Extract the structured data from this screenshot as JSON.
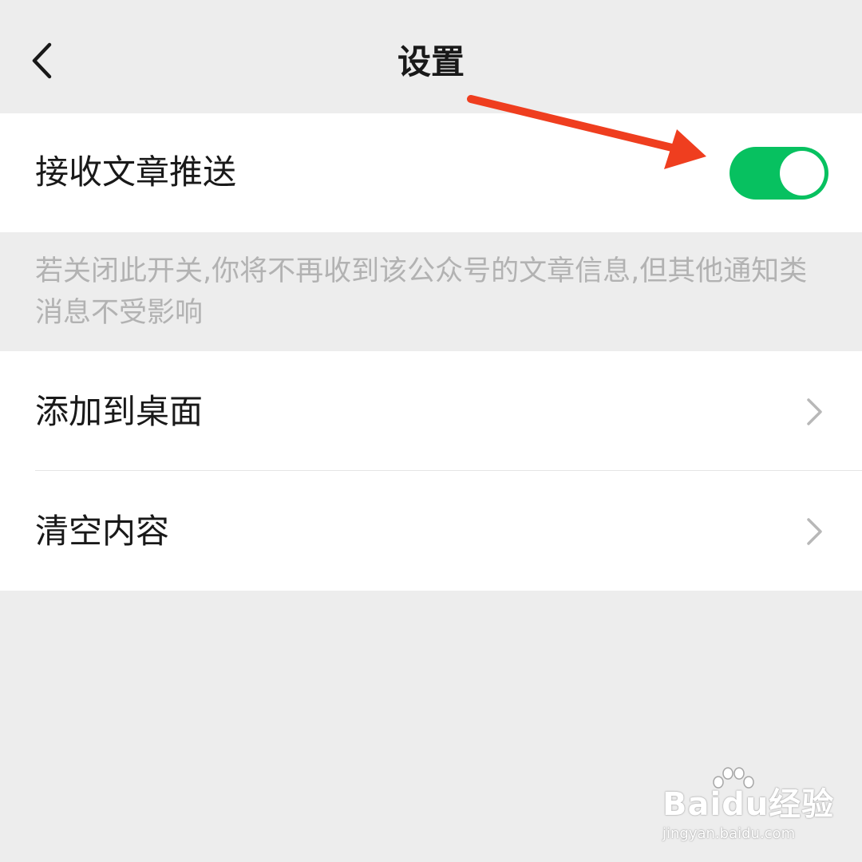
{
  "header": {
    "title": "设置",
    "back_icon": "chevron-left-icon"
  },
  "push_setting": {
    "label": "接收文章推送",
    "enabled": true,
    "toggle_color": "#07c160",
    "hint": "若关闭此开关,你将不再收到该公众号的文章信息,但其他通知类消息不受影响"
  },
  "actions": [
    {
      "label": "添加到桌面",
      "icon": "chevron-right-icon"
    },
    {
      "label": "清空内容",
      "icon": "chevron-right-icon"
    }
  ],
  "annotation": {
    "color": "#ef3e1f",
    "icon": "red-arrow-annotation"
  },
  "watermark": {
    "brand": "Baidu经验",
    "url": "jingyan.baidu.com"
  }
}
